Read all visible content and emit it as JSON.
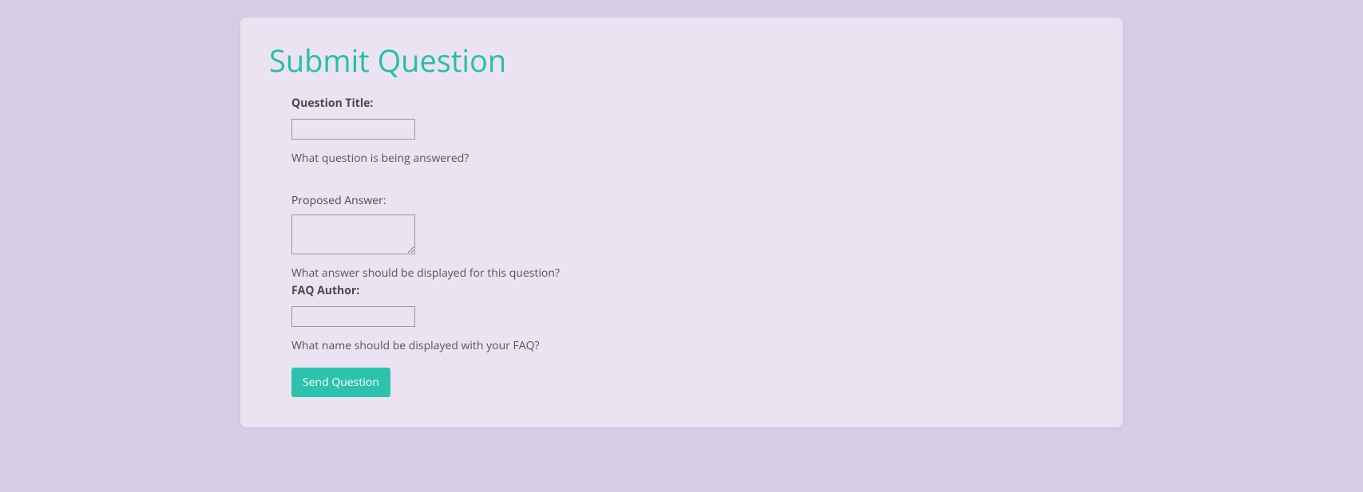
{
  "page": {
    "title": "Submit Question"
  },
  "form": {
    "question_title": {
      "label": "Question Title:",
      "value": "",
      "help": "What question is being answered?"
    },
    "proposed_answer": {
      "label": "Proposed Answer:",
      "value": "",
      "help": "What answer should be displayed for this question?"
    },
    "faq_author": {
      "label": "FAQ Author:",
      "value": "",
      "help": "What name should be displayed with your FAQ?"
    },
    "submit_label": "Send Question"
  }
}
